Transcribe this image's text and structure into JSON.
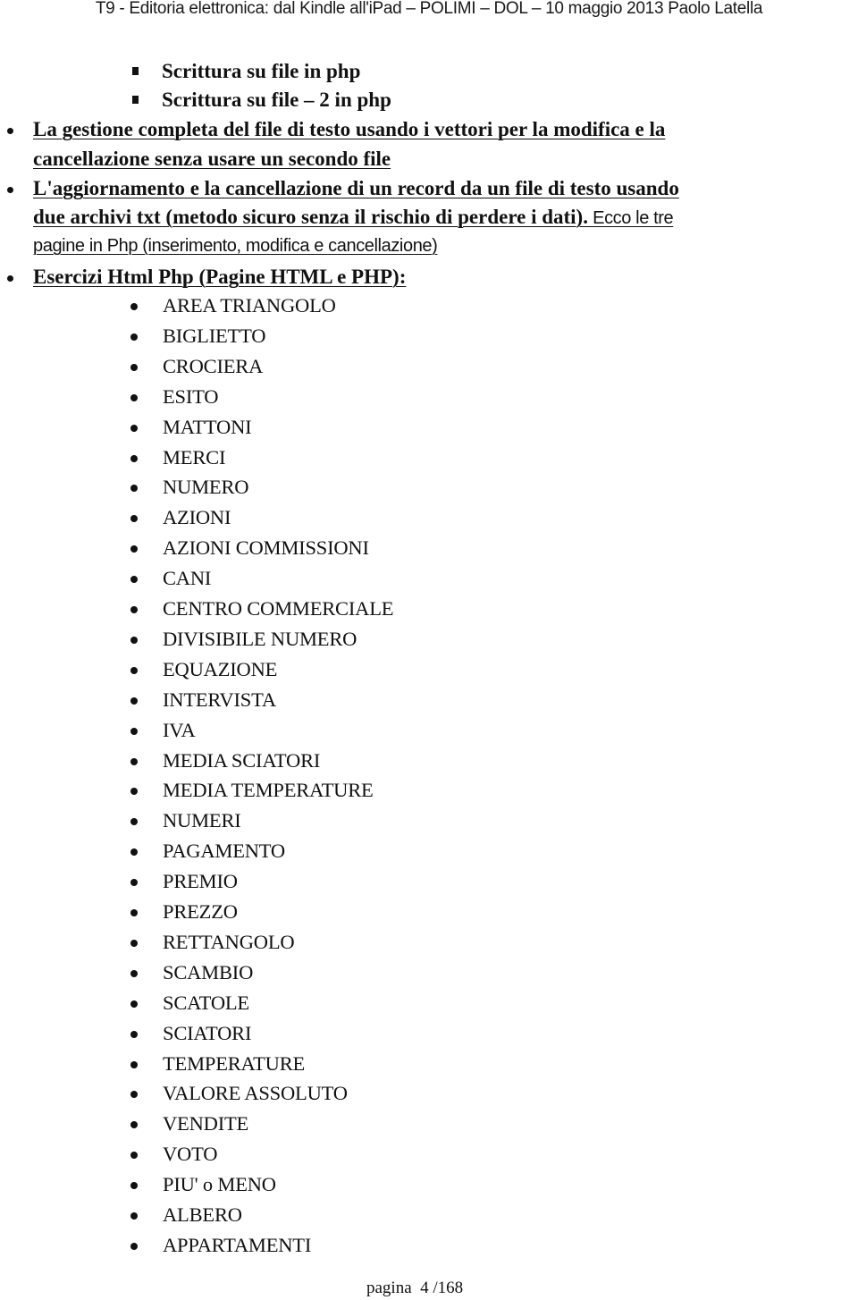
{
  "header": {
    "text": "T9 - Editoria elettronica: dal Kindle all'iPad – POLIMI – DOL –  10 maggio 2013  Paolo Latella"
  },
  "square_items": [
    {
      "label": "Scrittura su file in php"
    },
    {
      "label": "Scrittura su file – 2 in php"
    }
  ],
  "main_items": [
    {
      "lines": [
        "La gestione completa del file di testo usando i vettori per la modifica e la",
        "cancellazione senza usare un secondo file"
      ]
    },
    {
      "lines": [
        "L'aggiornamento e la cancellazione di un record da un file di testo usando",
        "due archivi txt (metodo sicuro senza il rischio di perdere i dati)."
      ],
      "tail_light": " Ecco le tre",
      "extra_line_light": "pagine in Php (inserimento, modifica e cancellazione)"
    },
    {
      "lines": [
        "Esercizi Html Php (Pagine HTML e PHP):"
      ]
    }
  ],
  "exercises": [
    "AREA TRIANGOLO",
    "BIGLIETTO",
    "CROCIERA",
    "ESITO",
    "MATTONI",
    "MERCI",
    "NUMERO",
    "AZIONI",
    "AZIONI COMMISSIONI",
    "CANI",
    "CENTRO COMMERCIALE",
    "DIVISIBILE NUMERO",
    "EQUAZIONE",
    "INTERVISTA",
    "IVA",
    "MEDIA SCIATORI",
    "MEDIA TEMPERATURE",
    "NUMERI",
    "PAGAMENTO",
    "PREMIO",
    "PREZZO",
    "RETTANGOLO",
    "SCAMBIO",
    "SCATOLE",
    "SCIATORI",
    "TEMPERATURE",
    "VALORE ASSOLUTO",
    "VENDITE",
    "VOTO",
    "PIU' o MENO",
    "ALBERO",
    "APPARTAMENTI"
  ],
  "footer": {
    "label": "pagina",
    "page": "4 /168"
  }
}
